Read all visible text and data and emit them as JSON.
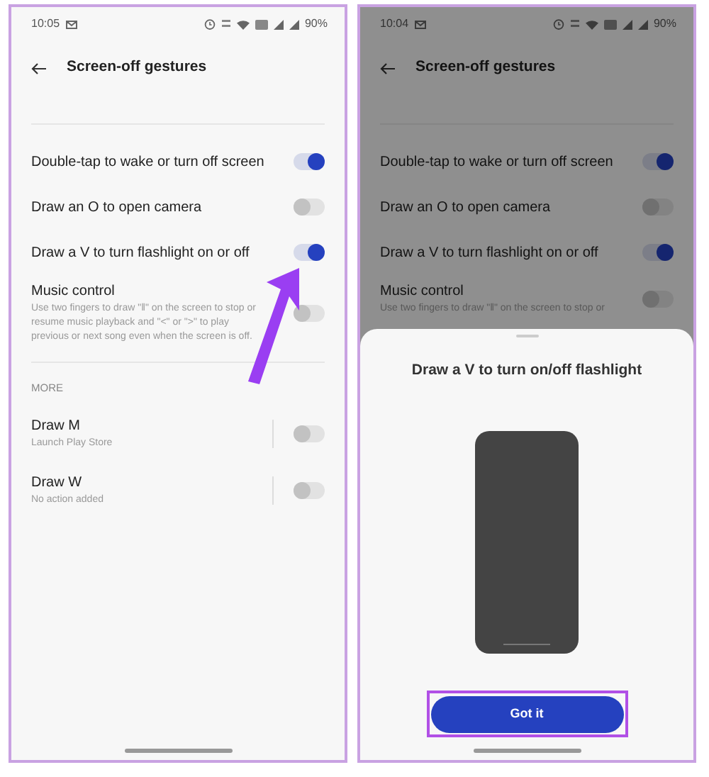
{
  "screens": [
    {
      "status_bar": {
        "time": "10:05",
        "battery": "90%"
      },
      "title": "Screen-off gestures",
      "dimmed": false,
      "settings": [
        {
          "label": "Double-tap to wake or turn off screen",
          "on": true
        },
        {
          "label": "Draw an O to open camera",
          "on": false
        },
        {
          "label": "Draw a V to turn flashlight on or off",
          "on": true
        },
        {
          "label": "Music control",
          "description": "Use two fingers to draw \"‖\" on the screen to stop or resume music playback and \"<\" or \">\" to play previous or next song even when the screen is off.",
          "on": false
        }
      ],
      "section": {
        "heading": "MORE",
        "items": [
          {
            "label": "Draw M",
            "description": "Launch Play Store",
            "on": false
          },
          {
            "label": "Draw W",
            "description": "No action added",
            "on": false
          }
        ]
      }
    },
    {
      "status_bar": {
        "time": "10:04",
        "battery": "90%"
      },
      "title": "Screen-off gestures",
      "dimmed": true,
      "settings": [
        {
          "label": "Double-tap to wake or turn off screen",
          "on": true
        },
        {
          "label": "Draw an O to open camera",
          "on": false
        },
        {
          "label": "Draw a V to turn flashlight on or off",
          "on": true
        },
        {
          "label": "Music control",
          "description": "Use two fingers to draw \"‖\" on the screen to stop or",
          "on": false
        }
      ],
      "sheet": {
        "title": "Draw a V to turn on/off flashlight",
        "button": "Got it"
      }
    }
  ]
}
